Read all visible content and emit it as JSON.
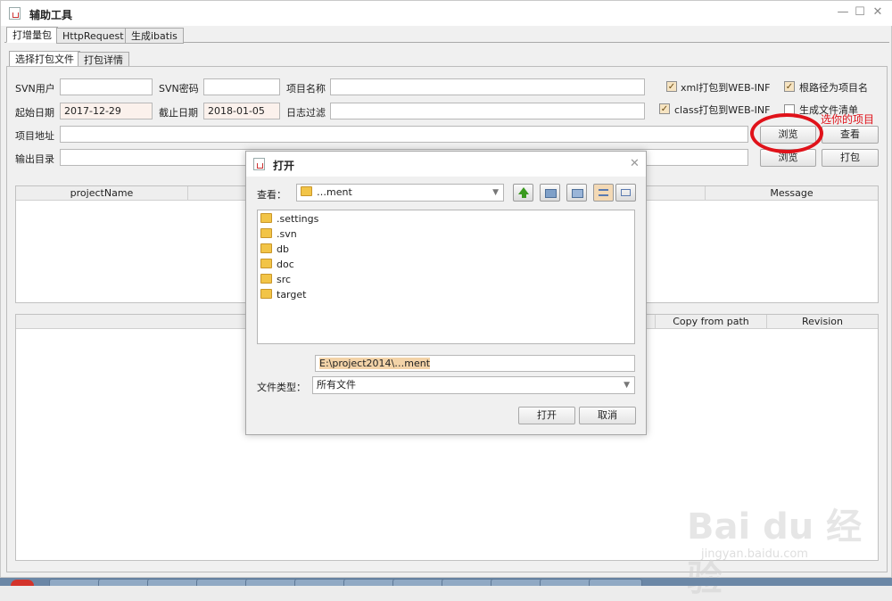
{
  "window": {
    "title": "辅助工具"
  },
  "tabs_top": [
    "打增量包",
    "HttpRequest",
    "生成ibatis"
  ],
  "tabs_sub": [
    "选择打包文件",
    "打包详情"
  ],
  "form": {
    "svn_user_label": "SVN用户",
    "svn_user_value": "",
    "svn_pwd_label": "SVN密码",
    "svn_pwd_value": "",
    "project_name_label": "项目名称",
    "project_name_value": "",
    "start_date_label": "起始日期",
    "start_date_value": "2017-12-29",
    "end_date_label": "截止日期",
    "end_date_value": "2018-01-05",
    "log_filter_label": "日志过滤",
    "log_filter_value": "",
    "project_path_label": "项目地址",
    "output_dir_label": "输出目录",
    "chk_xml": "xml打包到WEB-INF",
    "chk_root": "根路径为项目名",
    "chk_class": "class打包到WEB-INF",
    "chk_list": "生成文件清单",
    "browse1": "浏览",
    "view": "查看",
    "browse2": "浏览",
    "pack": "打包"
  },
  "table1": {
    "columns": [
      "projectName",
      "Message"
    ]
  },
  "table2": {
    "columns": [
      "Copy from path",
      "Revision"
    ]
  },
  "annotation": "选你的项目",
  "dialog": {
    "title": "打开",
    "look_in_label": "查看：",
    "look_in_value": "…ment",
    "files": [
      ".settings",
      ".svn",
      "db",
      "doc",
      "src",
      "target"
    ],
    "filename_value": "E:\\project2014\\…ment",
    "filetype_label": "文件类型：",
    "filetype_value": "所有文件",
    "open_btn": "打开",
    "cancel_btn": "取消"
  },
  "watermark": {
    "brand": "Bai du 经验",
    "url": "jingyan.baidu.com"
  }
}
